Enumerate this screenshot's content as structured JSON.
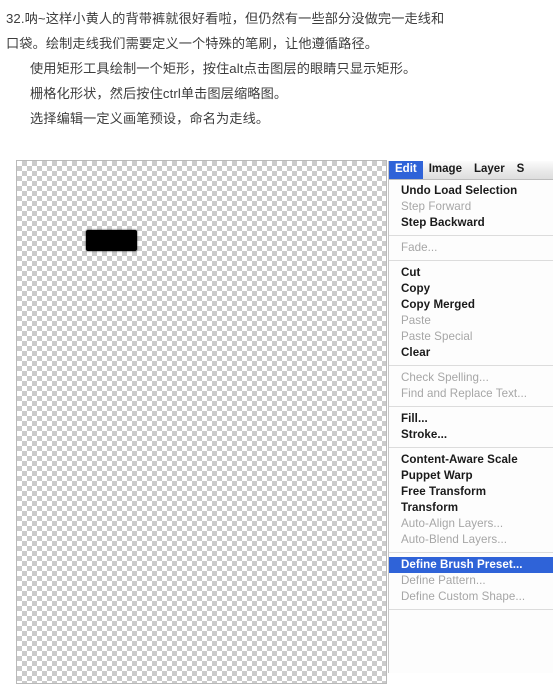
{
  "tutorial": {
    "lines": [
      {
        "text": "32.呐~这样小黄人的背带裤就很好看啦，但仍然有一些部分没做完一走线和",
        "indent": false
      },
      {
        "text": "口袋。绘制走线我们需要定义一个特殊的笔刷，让他遵循路径。",
        "indent": false
      },
      {
        "text": "使用矩形工具绘制一个矩形，按住alt点击图层的眼睛只显示矩形。",
        "indent": true
      },
      {
        "text": "栅格化形状，然后按住ctrl单击图层缩略图。",
        "indent": true
      },
      {
        "text": "选择编辑一定义画笔预设，命名为走线。",
        "indent": true
      }
    ]
  },
  "canvas": {
    "name": "transparent-canvas",
    "checker_light": "#ffffff",
    "checker_dark": "#cbcbcb",
    "shape_color": "#000000"
  },
  "menubar": {
    "items": [
      {
        "label": "Edit",
        "active": true
      },
      {
        "label": "Image",
        "active": false
      },
      {
        "label": "Layer",
        "active": false
      },
      {
        "label": "S",
        "active": false,
        "truncated": true
      }
    ]
  },
  "edit_menu": {
    "highlight_color": "#2f63d8",
    "items": [
      {
        "type": "item",
        "label": "Undo Load Selection",
        "disabled": false,
        "highlighted": false
      },
      {
        "type": "item",
        "label": "Step Forward",
        "disabled": true,
        "highlighted": false
      },
      {
        "type": "item",
        "label": "Step Backward",
        "disabled": false,
        "highlighted": false
      },
      {
        "type": "separator"
      },
      {
        "type": "item",
        "label": "Fade...",
        "disabled": true,
        "highlighted": false
      },
      {
        "type": "separator"
      },
      {
        "type": "item",
        "label": "Cut",
        "disabled": false,
        "highlighted": false
      },
      {
        "type": "item",
        "label": "Copy",
        "disabled": false,
        "highlighted": false
      },
      {
        "type": "item",
        "label": "Copy Merged",
        "disabled": false,
        "highlighted": false
      },
      {
        "type": "item",
        "label": "Paste",
        "disabled": true,
        "highlighted": false
      },
      {
        "type": "item",
        "label": "Paste Special",
        "disabled": true,
        "highlighted": false
      },
      {
        "type": "item",
        "label": "Clear",
        "disabled": false,
        "highlighted": false
      },
      {
        "type": "separator"
      },
      {
        "type": "item",
        "label": "Check Spelling...",
        "disabled": true,
        "highlighted": false
      },
      {
        "type": "item",
        "label": "Find and Replace Text...",
        "disabled": true,
        "highlighted": false
      },
      {
        "type": "separator"
      },
      {
        "type": "item",
        "label": "Fill...",
        "disabled": false,
        "highlighted": false
      },
      {
        "type": "item",
        "label": "Stroke...",
        "disabled": false,
        "highlighted": false
      },
      {
        "type": "separator"
      },
      {
        "type": "item",
        "label": "Content-Aware Scale",
        "disabled": false,
        "highlighted": false
      },
      {
        "type": "item",
        "label": "Puppet Warp",
        "disabled": false,
        "highlighted": false
      },
      {
        "type": "item",
        "label": "Free Transform",
        "disabled": false,
        "highlighted": false
      },
      {
        "type": "item",
        "label": "Transform",
        "disabled": false,
        "highlighted": false
      },
      {
        "type": "item",
        "label": "Auto-Align Layers...",
        "disabled": true,
        "highlighted": false
      },
      {
        "type": "item",
        "label": "Auto-Blend Layers...",
        "disabled": true,
        "highlighted": false
      },
      {
        "type": "separator"
      },
      {
        "type": "item",
        "label": "Define Brush Preset...",
        "disabled": false,
        "highlighted": true
      },
      {
        "type": "item",
        "label": "Define Pattern...",
        "disabled": true,
        "highlighted": false
      },
      {
        "type": "item",
        "label": "Define Custom Shape...",
        "disabled": true,
        "highlighted": false
      },
      {
        "type": "separator"
      }
    ]
  }
}
